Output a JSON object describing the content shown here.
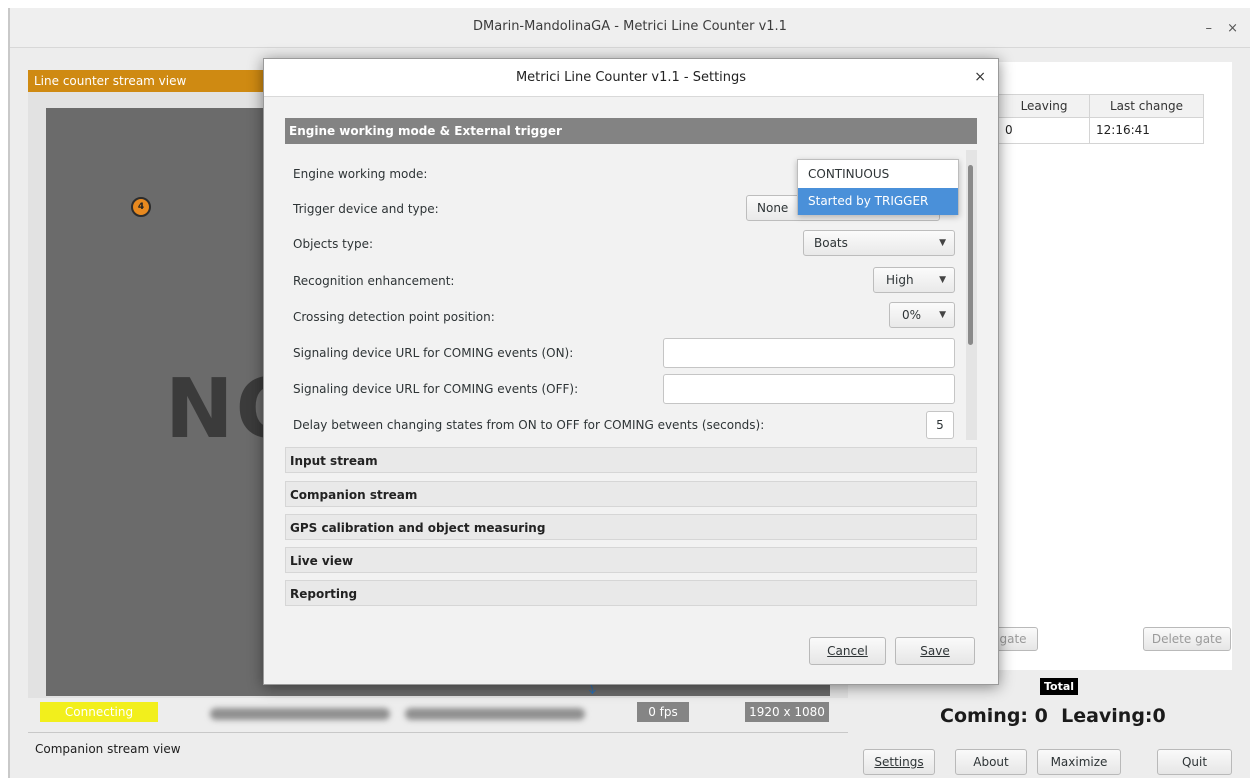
{
  "window": {
    "title": "DMarin-MandolinaGA - Metrici Line Counter v1.1",
    "minimize_glyph": "–",
    "close_glyph": "×"
  },
  "left_panel": {
    "header": "Line counter stream view",
    "no_signal_text": "NO",
    "marker_label": "4",
    "status": "Connecting",
    "fps": "0 fps",
    "resolution": "1920 x 1080",
    "companion_header": "Companion stream view"
  },
  "right_panel": {
    "table": {
      "columns": [
        "Leaving",
        "Last change"
      ],
      "rows": [
        [
          "0",
          "12:16:41"
        ]
      ]
    },
    "gate_button_partial": "gate",
    "delete_gate_button": "Delete gate",
    "total_label": "Total",
    "totals": "Coming: 0  Leaving:0",
    "buttons": {
      "settings": "Settings",
      "about": "About",
      "maximize": "Maximize",
      "quit": "Quit"
    }
  },
  "dialog": {
    "title": "Metrici Line Counter v1.1 - Settings",
    "close_glyph": "×",
    "active_section": "Engine working mode & External trigger",
    "rows": {
      "engine_mode": "Engine working mode:",
      "trigger_device": "Trigger device and type:",
      "objects_type": "Objects type:",
      "recognition": "Recognition enhancement:",
      "crossing_point": "Crossing detection point position:",
      "url_on": "Signaling device URL for COMING events (ON):",
      "url_off": "Signaling device URL for COMING events (OFF):",
      "delay": "Delay between changing states from ON to OFF for COMING events (seconds):"
    },
    "values": {
      "trigger_device": "None",
      "objects_type": "Boats",
      "recognition": "High",
      "crossing_point": "0%",
      "delay": "5"
    },
    "engine_mode_options": [
      "CONTINUOUS",
      "Started by TRIGGER"
    ],
    "engine_mode_highlighted": "Started by TRIGGER",
    "collapsed_sections": [
      "Input stream",
      "Companion stream",
      "GPS calibration and object measuring",
      "Live view",
      "Reporting"
    ],
    "cancel_button": "Cancel",
    "save_button": "Save"
  },
  "icons": {
    "dropdown_arrow": "▼",
    "marker_icon": "numbered-circle"
  },
  "colors": {
    "accent_orange": "#cf8a12",
    "status_yellow": "#f2ef1c",
    "selection_blue": "#4a90d9",
    "section_gray": "#838383"
  }
}
